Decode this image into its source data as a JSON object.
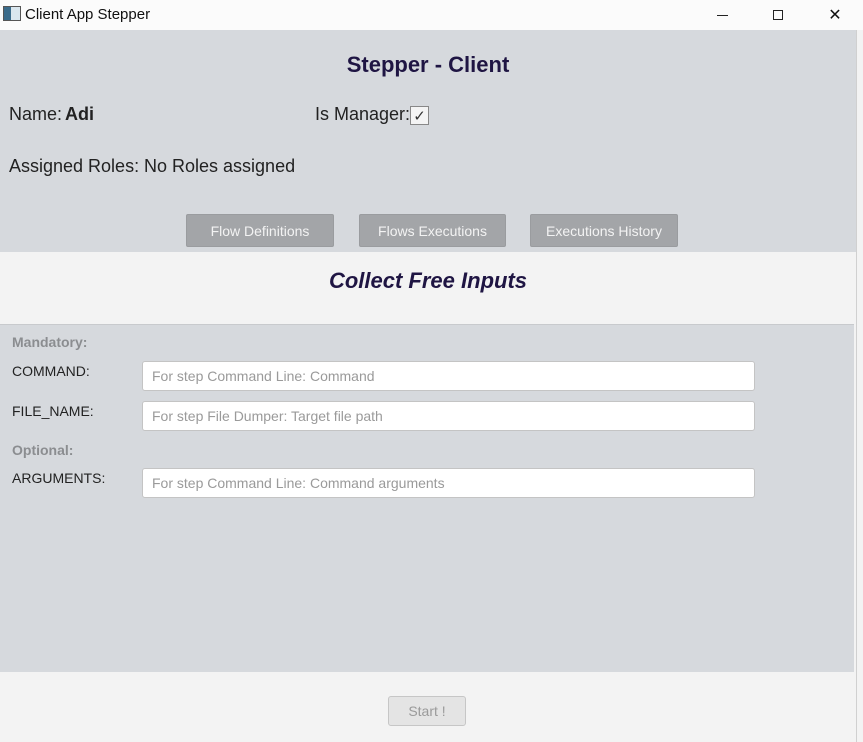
{
  "window": {
    "title": "Client App Stepper",
    "icon": "app-icon",
    "controls": {
      "minimize_icon": "minimize-icon",
      "maximize_icon": "maximize-icon",
      "close_icon": "close-icon",
      "close_glyph": "✕"
    }
  },
  "header": {
    "title": "Stepper - Client",
    "name_label": "Name:",
    "name_value": "Adi",
    "manager_label": "Is Manager:",
    "manager_checked": true,
    "manager_glyph": "✓",
    "roles_label": "Assigned Roles:",
    "roles_value": "No Roles assigned"
  },
  "nav": {
    "flow_definitions": "Flow Definitions",
    "flows_executions": "Flows Executions",
    "executions_history": "Executions History"
  },
  "section": {
    "title": "Collect Free Inputs"
  },
  "inputs": {
    "mandatory_label": "Mandatory:",
    "optional_label": "Optional:",
    "command": {
      "label": "COMMAND:",
      "value": "",
      "placeholder": "For step Command Line: Command"
    },
    "file_name": {
      "label": "FILE_NAME:",
      "value": "",
      "placeholder": "For step File Dumper: Target file path"
    },
    "arguments": {
      "label": "ARGUMENTS:",
      "value": "",
      "placeholder": "For step Command Line: Command arguments"
    }
  },
  "actions": {
    "start": "Start !"
  },
  "colors": {
    "heading": "#1f1543",
    "panel": "#d6d9dd",
    "nav_button": "#a3a5a8"
  }
}
